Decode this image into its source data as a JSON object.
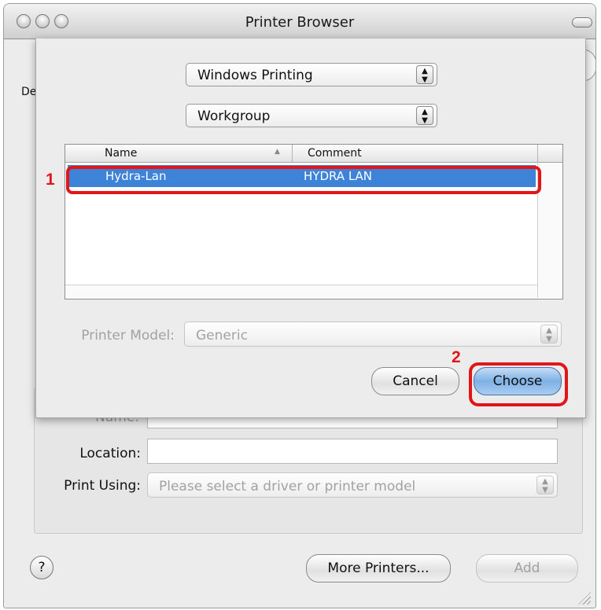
{
  "window": {
    "title": "Printer Browser",
    "behind_sheet_fragment": "De"
  },
  "sheet": {
    "connection_select": "Windows Printing",
    "workgroup_select": "Workgroup",
    "list": {
      "columns": [
        "Name",
        "Comment"
      ],
      "sort_indicator": "▲",
      "rows": [
        {
          "name": "Hydra-Lan",
          "comment": "HYDRA LAN",
          "selected": true
        }
      ]
    },
    "printer_model": {
      "label": "Printer Model:",
      "value": "Generic"
    },
    "cancel_label": "Cancel",
    "choose_label": "Choose"
  },
  "form": {
    "name_label": "Name:",
    "location_label": "Location:",
    "location_value": "",
    "print_using_label": "Print Using:",
    "print_using_placeholder": "Please select a driver or printer model"
  },
  "footer": {
    "help_label": "?",
    "more_printers_label": "More Printers...",
    "add_label": "Add"
  },
  "annotations": {
    "step1": "1",
    "step2": "2",
    "color": "#e0161b"
  },
  "colors": {
    "selection": "#3d84d8",
    "default_button": "#7fb0e4"
  }
}
